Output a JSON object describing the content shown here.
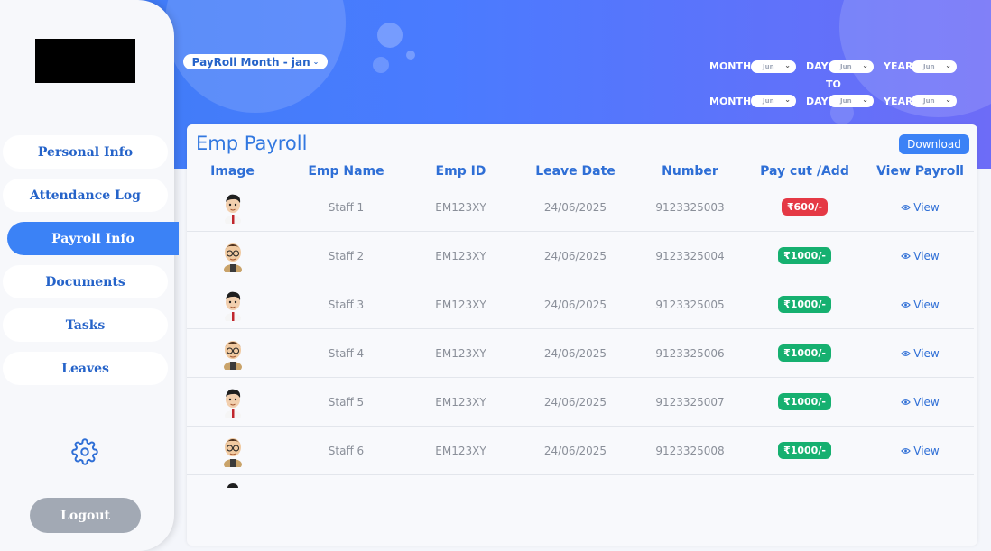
{
  "sidebar": {
    "items": [
      {
        "label": "Personal Info",
        "active": false
      },
      {
        "label": "Attendance Log",
        "active": false
      },
      {
        "label": "Payroll Info",
        "active": true
      },
      {
        "label": "Documents",
        "active": false
      },
      {
        "label": "Tasks",
        "active": false
      },
      {
        "label": "Leaves",
        "active": false
      }
    ],
    "settings_icon": "gear-icon",
    "logout_label": "Logout"
  },
  "header": {
    "payroll_month_label": "PayRoll Month - jan",
    "filters": {
      "month_label": "MONTH",
      "day_label": "DAY",
      "year_label": "YEAR",
      "to_label": "TO",
      "from": {
        "month": "Jun",
        "day": "Jun",
        "year": "Jun"
      },
      "to": {
        "month": "Jun",
        "day": "Jun",
        "year": "Jun"
      }
    }
  },
  "payroll": {
    "title": "Emp Payroll",
    "download_label": "Download",
    "columns": [
      "Image",
      "Emp Name",
      "Emp ID",
      "Leave Date",
      "Number",
      "Pay cut /Add",
      "View Payroll"
    ],
    "view_label": "View",
    "rows": [
      {
        "name": "Staff 1",
        "emp_id": "EM123XY",
        "leave_date": "24/06/2025",
        "number": "9123325003",
        "pay": "₹600/-",
        "pay_type": "cut",
        "avatar": "avatar-boy-tie"
      },
      {
        "name": "Staff 2",
        "emp_id": "EM123XY",
        "leave_date": "24/06/2025",
        "number": "9123325004",
        "pay": "₹1000/-",
        "pay_type": "add",
        "avatar": "avatar-boy-glasses"
      },
      {
        "name": "Staff 3",
        "emp_id": "EM123XY",
        "leave_date": "24/06/2025",
        "number": "9123325005",
        "pay": "₹1000/-",
        "pay_type": "add",
        "avatar": "avatar-boy-tie"
      },
      {
        "name": "Staff 4",
        "emp_id": "EM123XY",
        "leave_date": "24/06/2025",
        "number": "9123325006",
        "pay": "₹1000/-",
        "pay_type": "add",
        "avatar": "avatar-boy-glasses"
      },
      {
        "name": "Staff 5",
        "emp_id": "EM123XY",
        "leave_date": "24/06/2025",
        "number": "9123325007",
        "pay": "₹1000/-",
        "pay_type": "add",
        "avatar": "avatar-boy-tie"
      },
      {
        "name": "Staff 6",
        "emp_id": "EM123XY",
        "leave_date": "24/06/2025",
        "number": "9123325008",
        "pay": "₹1000/-",
        "pay_type": "add",
        "avatar": "avatar-boy-glasses"
      }
    ]
  },
  "colors": {
    "accent": "#3b82f6",
    "pay_cut": "#e53945",
    "pay_add": "#16b070"
  }
}
